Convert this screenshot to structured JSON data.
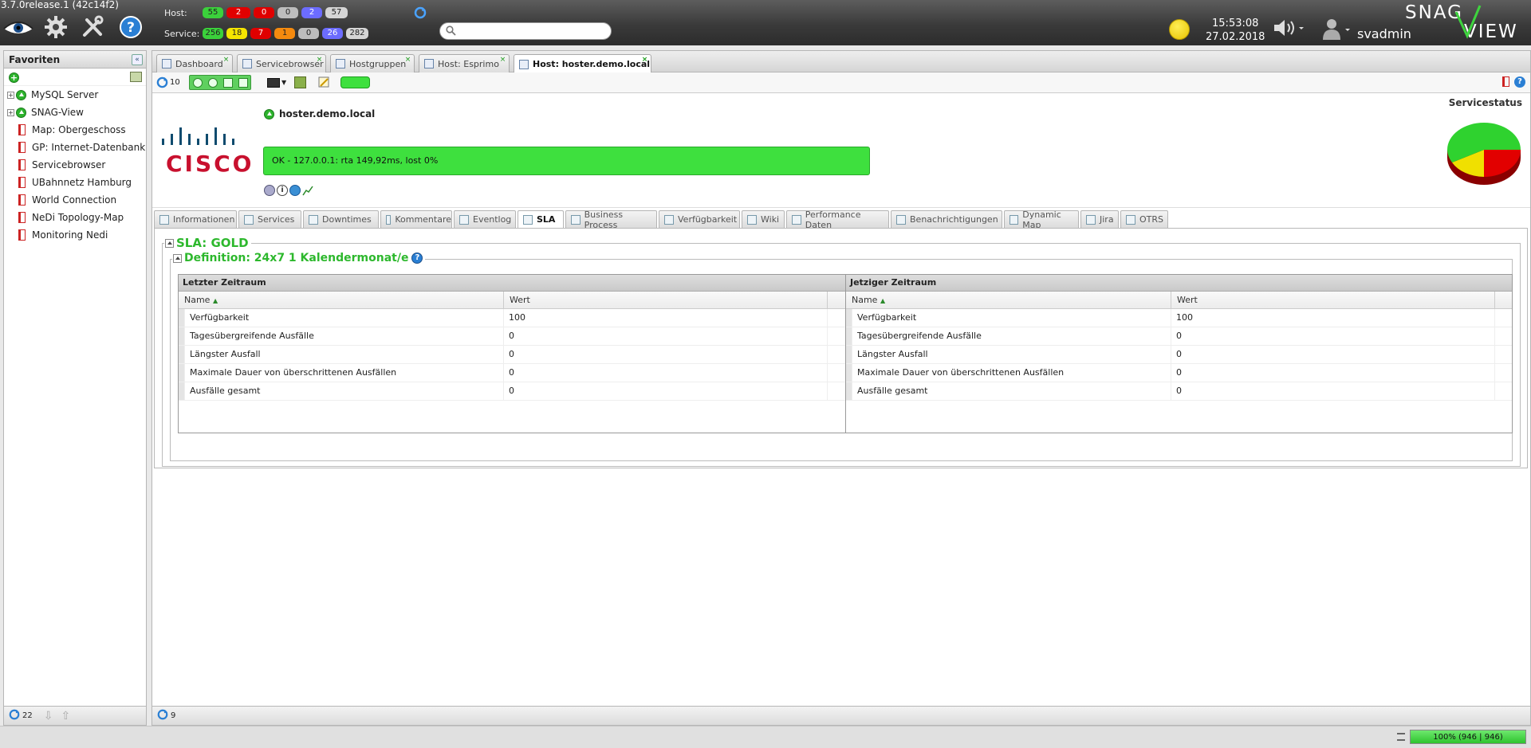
{
  "app": {
    "version": "3.7.0release.1 (42c14f2)"
  },
  "header": {
    "host_label": "Host:",
    "service_label": "Service:",
    "host_counts": [
      {
        "value": "55",
        "color": "#3bd13b"
      },
      {
        "value": "2",
        "color": "#e00000"
      },
      {
        "value": "0",
        "color": "#e00000"
      },
      {
        "value": "0",
        "color": "#bdbdbd"
      },
      {
        "value": "2",
        "color": "#6c6cff"
      },
      {
        "value": "57",
        "color": "#d5d5d5"
      }
    ],
    "service_counts": [
      {
        "value": "256",
        "color": "#3bd13b"
      },
      {
        "value": "18",
        "color": "#f5e500"
      },
      {
        "value": "7",
        "color": "#e00000"
      },
      {
        "value": "1",
        "color": "#f58a0e"
      },
      {
        "value": "0",
        "color": "#bdbdbd"
      },
      {
        "value": "26",
        "color": "#6c6cff"
      },
      {
        "value": "282",
        "color": "#d5d5d5"
      }
    ],
    "search_placeholder": "",
    "time": "15:53:08",
    "date": "27.02.2018",
    "username": "svadmin",
    "logo_text_1": "SNAG",
    "logo_text_2": "VIEW"
  },
  "sidebar": {
    "title": "Favoriten",
    "items": [
      {
        "label": "MySQL Server",
        "type": "group"
      },
      {
        "label": "SNAG-View",
        "type": "group"
      },
      {
        "label": "Map: Obergeschoss",
        "type": "link"
      },
      {
        "label": "GP: Internet-Datenbank",
        "type": "link"
      },
      {
        "label": "Servicebrowser",
        "type": "link"
      },
      {
        "label": "UBahnnetz Hamburg",
        "type": "link"
      },
      {
        "label": "World Connection",
        "type": "link"
      },
      {
        "label": "NeDi Topology-Map",
        "type": "link"
      },
      {
        "label": "Monitoring Nedi",
        "type": "link"
      }
    ],
    "footer_count": "22"
  },
  "tabs": [
    {
      "label": "Dashboard"
    },
    {
      "label": "Servicebrowser"
    },
    {
      "label": "Hostgruppen"
    },
    {
      "label": "Host: Esprimo"
    },
    {
      "label": "Host: hoster.demo.local",
      "active": true
    }
  ],
  "toolbar": {
    "refresh_count": "10"
  },
  "host": {
    "name": "hoster.demo.local",
    "status_text": "OK - 127.0.0.1: rta 149,92ms, lost 0%",
    "vendor_logo": "CISCO",
    "servicestatus_label": "Servicestatus"
  },
  "subtabs": [
    {
      "label": "Informationen"
    },
    {
      "label": "Services"
    },
    {
      "label": "Downtimes"
    },
    {
      "label": "Kommentare"
    },
    {
      "label": "Eventlog"
    },
    {
      "label": "SLA",
      "active": true
    },
    {
      "label": "Business Process"
    },
    {
      "label": "Verfügbarkeit"
    },
    {
      "label": "Wiki"
    },
    {
      "label": "Performance Daten"
    },
    {
      "label": "Benachrichtigungen"
    },
    {
      "label": "Dynamic Map"
    },
    {
      "label": "Jira"
    },
    {
      "label": "OTRS"
    }
  ],
  "sla": {
    "title": "SLA: GOLD",
    "definition": "Definition: 24x7 1 Kalendermonat/e",
    "last_period": {
      "title": "Letzter Zeitraum",
      "col_name": "Name",
      "col_value": "Wert",
      "rows": [
        {
          "name": "Verfügbarkeit",
          "value": "100"
        },
        {
          "name": "Tagesübergreifende Ausfälle",
          "value": "0"
        },
        {
          "name": "Längster Ausfall",
          "value": "0"
        },
        {
          "name": "Maximale Dauer von überschrittenen Ausfällen",
          "value": "0"
        },
        {
          "name": "Ausfälle gesamt",
          "value": "0"
        }
      ]
    },
    "current_period": {
      "title": "Jetziger Zeitraum",
      "col_name": "Name",
      "col_value": "Wert",
      "rows": [
        {
          "name": "Verfügbarkeit",
          "value": "100"
        },
        {
          "name": "Tagesübergreifende Ausfälle",
          "value": "0"
        },
        {
          "name": "Längster Ausfall",
          "value": "0"
        },
        {
          "name": "Maximale Dauer von überschrittenen Ausfällen",
          "value": "0"
        },
        {
          "name": "Ausfälle gesamt",
          "value": "0"
        }
      ]
    }
  },
  "main_footer": {
    "count": "9"
  },
  "statusbar": {
    "progress_text": "100% (946 | 946)",
    "progress_fraction": 1.0
  },
  "colors": {
    "ok": "#3ee03e",
    "accent_green": "#2db82d",
    "critical": "#e00000",
    "warning": "#f5e500"
  },
  "icons": [
    "eye-icon",
    "gear-icon",
    "tools-icon",
    "help-icon",
    "refresh-icon",
    "search-icon",
    "sun-icon",
    "speaker-icon",
    "user-icon"
  ]
}
